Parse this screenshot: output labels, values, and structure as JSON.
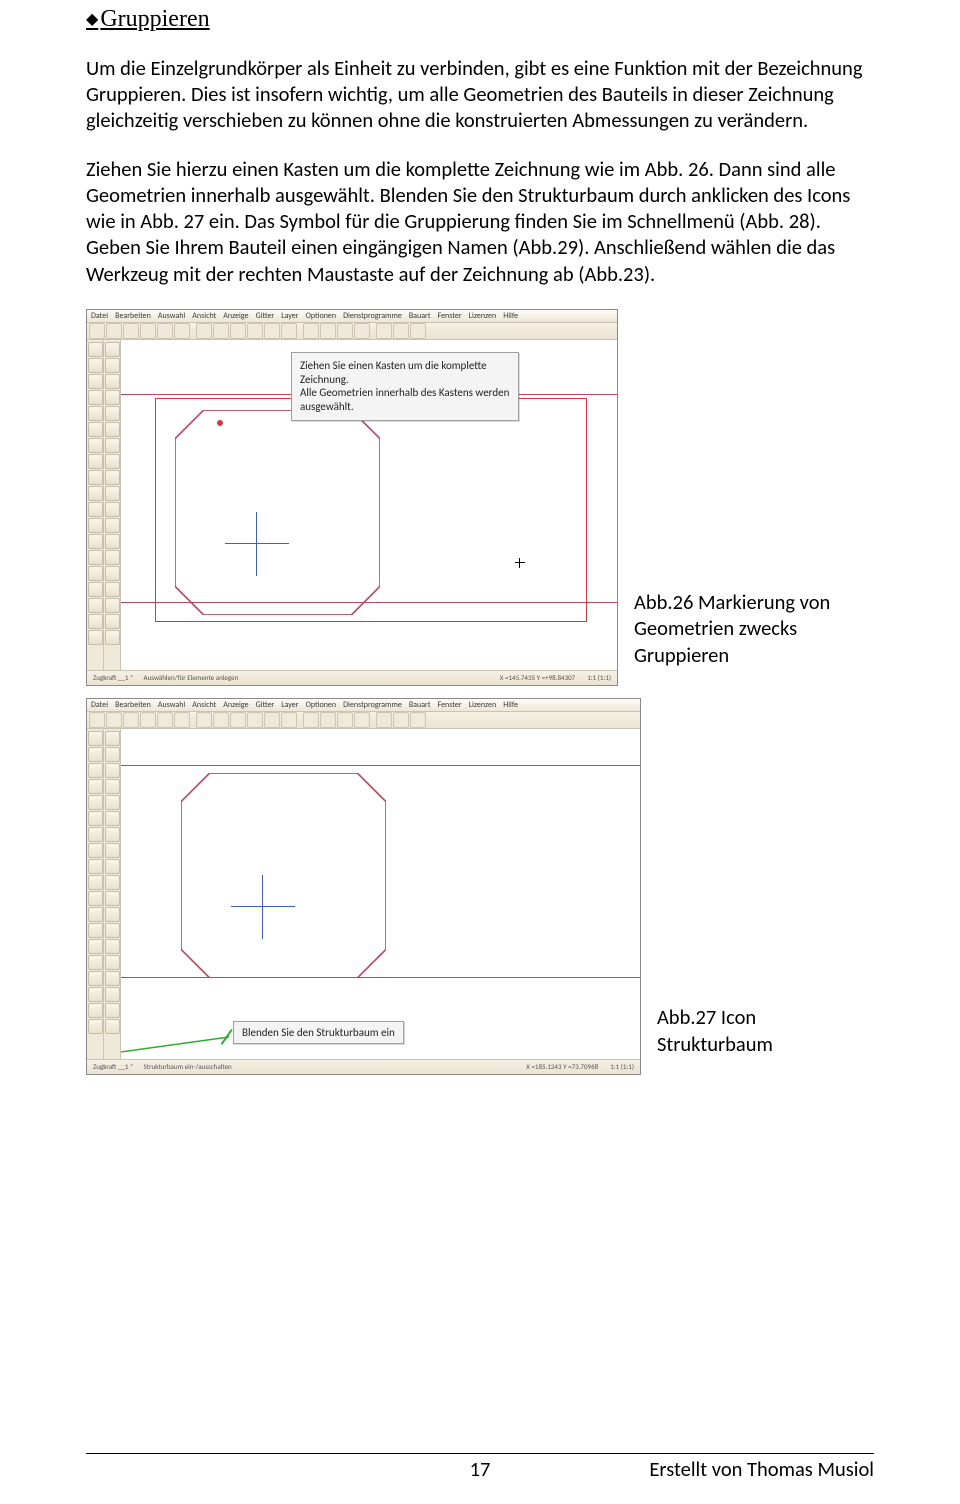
{
  "section": {
    "title": "Gruppieren"
  },
  "paragraphs": {
    "p1": "Um die Einzelgrundkörper als Einheit zu verbinden, gibt es eine Funktion mit der Bezeichnung Gruppieren. Dies ist insofern wichtig, um alle Geometrien des Bauteils in dieser Zeichnung gleichzeitig verschieben zu können ohne die konstruierten Abmessungen zu verändern.",
    "p2": "Ziehen Sie hierzu einen Kasten um die komplette Zeichnung wie im Abb. 26. Dann sind alle Geometrien innerhalb ausgewählt. Blenden Sie den Strukturbaum durch anklicken des Icons wie in Abb. 27 ein. Das Symbol für die Gruppierung finden Sie im Schnellmenü (Abb. 28). Geben Sie Ihrem Bauteil einen eingängigen Namen (Abb.29). Anschließend wählen die das Werkzeug mit der rechten Maustaste auf der Zeichnung ab (Abb.23)."
  },
  "captions": {
    "c1": "Abb.26 Markierung von Geometrien zwecks Gruppieren",
    "c2": "Abb.27 Icon Strukturbaum"
  },
  "cad": {
    "menus": [
      "Datei",
      "Bearbeiten",
      "Auswahl",
      "Ansicht",
      "Anzeige",
      "Gitter",
      "Layer",
      "Optionen",
      "Dienstprogramme",
      "Bauart",
      "Fenster",
      "Lizenzen",
      "Hilfe"
    ],
    "hint1_l1": "Ziehen Sie einen Kasten um die komplette Zeichnung.",
    "hint1_l2": "Alle Geometrien innerhalb des Kastens werden ausgewählt.",
    "status1_left": "Zugkraft __1 *",
    "status1_mid": "Auswählen/für Elemente anlegen",
    "coords1": "X =145.7435   Y =+98.84307",
    "scale1": "1:1 (1:1)",
    "hint2": "Blenden Sie den Strukturbaum ein",
    "status2_left": "Zugkraft __1 *",
    "status2_mid": "Strukturbaum ein-/ausschalten",
    "coords2": "X =185.1243   Y =73.70968",
    "scale2": "1:1 (1:1)"
  },
  "footer": {
    "page": "17",
    "author": "Erstellt von Thomas Musiol"
  }
}
